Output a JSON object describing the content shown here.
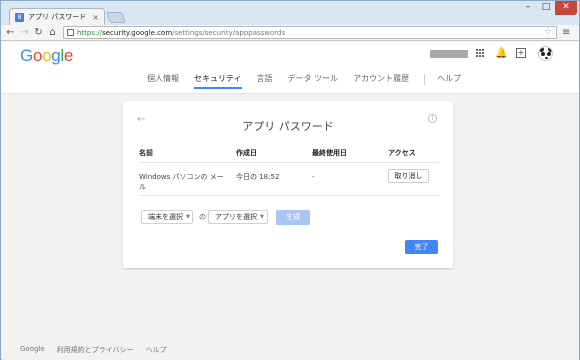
{
  "browser": {
    "tab_title": "アプリ パスワード - アカウント設定",
    "tab_close": "×",
    "url_scheme": "https://",
    "url_host": "security.google.com",
    "url_path": "/settings/security/apppasswords",
    "window_controls": {
      "minimize": "–",
      "maximize": "□",
      "close": "✕"
    },
    "nav_icons": {
      "back": "←",
      "forward": "→",
      "reload": "↻",
      "home": "⌂",
      "star": "☆",
      "menu": "≡"
    }
  },
  "header": {
    "logo": {
      "G": "G",
      "o1": "o",
      "o2": "o",
      "g": "g",
      "l": "l",
      "e": "e"
    },
    "icons": {
      "bell": "🔔",
      "plus": "+"
    },
    "nav": [
      {
        "label": "個人情報",
        "active": false
      },
      {
        "label": "セキュリティ",
        "active": true
      },
      {
        "label": "言語",
        "active": false
      },
      {
        "label": "データ ツール",
        "active": false
      },
      {
        "label": "アカウント履歴",
        "active": false
      },
      {
        "label": "ヘルプ",
        "active": false
      }
    ]
  },
  "card": {
    "title": "アプリ パスワード",
    "back_icon": "←",
    "info_icon": "i",
    "columns": [
      "名前",
      "作成日",
      "最終使用日",
      "アクセス"
    ],
    "rows": [
      {
        "name": "Windows パソコンの メール",
        "created": "今日の 18:52",
        "last_used": "-",
        "action": "取り消し"
      }
    ],
    "device_select": "端末を選択",
    "of_text": "の",
    "app_select": "アプリを選択",
    "caret": "▼",
    "generate_button": "生成",
    "done_button": "完了"
  },
  "footer": [
    "Google",
    "利用規約とプライバシー",
    "ヘルプ"
  ],
  "colors": {
    "accent": "#4285f4",
    "disabled_button": "#a9c4f5",
    "secure_green": "#2e8b3a"
  }
}
